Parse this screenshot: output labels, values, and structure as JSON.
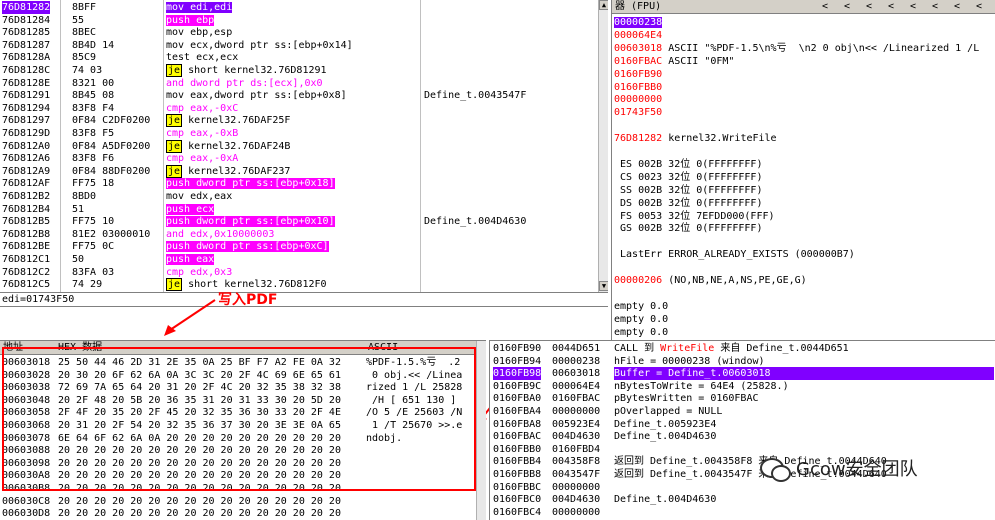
{
  "disasm": {
    "rows": [
      {
        "addr": "76D81282",
        "bytes": "8BFF",
        "asm": "mov edi,edi",
        "cmt": "",
        "sel": true,
        "cls": "sel"
      },
      {
        "addr": "76D81284",
        "bytes": "55",
        "asm": "push ebp",
        "cmt": "",
        "cls": "push"
      },
      {
        "addr": "76D81285",
        "bytes": "8BEC",
        "asm": "mov ebp,esp",
        "cmt": ""
      },
      {
        "addr": "76D81287",
        "bytes": "8B4D 14",
        "asm": "mov ecx,dword ptr ss:[ebp+0x14]",
        "cmt": ""
      },
      {
        "addr": "76D8128A",
        "bytes": "85C9",
        "asm": "test ecx,ecx",
        "cmt": ""
      },
      {
        "addr": "76D8128C",
        "bytes": "74 03",
        "asm": "short kernel32.76D81291",
        "cmt": "",
        "je": "je"
      },
      {
        "addr": "76D8128E",
        "bytes": "8321 00",
        "asm": "and dword ptr ds:[ecx],0x0",
        "cmt": "",
        "cls": "cmp"
      },
      {
        "addr": "76D81291",
        "bytes": "8B45 08",
        "asm": "mov eax,dword ptr ss:[ebp+0x8]",
        "cmt": "Define_t.0043547F"
      },
      {
        "addr": "76D81294",
        "bytes": "83F8 F4",
        "asm": "cmp eax,-0xC",
        "cmt": "",
        "cls": "cmp"
      },
      {
        "addr": "76D81297",
        "bytes": "0F84 C2DF0200",
        "asm": "kernel32.76DAF25F",
        "cmt": "",
        "je": "je"
      },
      {
        "addr": "76D8129D",
        "bytes": "83F8 F5",
        "asm": "cmp eax,-0xB",
        "cmt": "",
        "cls": "cmp"
      },
      {
        "addr": "76D812A0",
        "bytes": "0F84 A5DF0200",
        "asm": "kernel32.76DAF24B",
        "cmt": "",
        "je": "je"
      },
      {
        "addr": "76D812A6",
        "bytes": "83F8 F6",
        "asm": "cmp eax,-0xA",
        "cmt": "",
        "cls": "cmp"
      },
      {
        "addr": "76D812A9",
        "bytes": "0F84 88DF0200",
        "asm": "kernel32.76DAF237",
        "cmt": "",
        "je": "je"
      },
      {
        "addr": "76D812AF",
        "bytes": "FF75 18",
        "asm": "push dword ptr ss:[ebp+0x18]",
        "cmt": "",
        "cls": "push"
      },
      {
        "addr": "76D812B2",
        "bytes": "8BD0",
        "asm": "mov edx,eax",
        "cmt": ""
      },
      {
        "addr": "76D812B4",
        "bytes": "51",
        "asm": "push ecx",
        "cmt": "",
        "cls": "push"
      },
      {
        "addr": "76D812B5",
        "bytes": "FF75 10",
        "asm": "push dword ptr ss:[ebp+0x10]",
        "cmt": "Define_t.004D4630",
        "cls": "push"
      },
      {
        "addr": "76D812B8",
        "bytes": "81E2 03000010",
        "asm": "and edx,0x10000003",
        "cmt": "",
        "cls": "cmp"
      },
      {
        "addr": "76D812BE",
        "bytes": "FF75 0C",
        "asm": "push dword ptr ss:[ebp+0xC]",
        "cmt": "",
        "cls": "push"
      },
      {
        "addr": "76D812C1",
        "bytes": "50",
        "asm": "push eax",
        "cmt": "",
        "cls": "push"
      },
      {
        "addr": "76D812C2",
        "bytes": "83FA 03",
        "asm": "cmp edx,0x3",
        "cmt": "",
        "cls": "cmp"
      },
      {
        "addr": "76D812C5",
        "bytes": "74 29",
        "asm": "short kernel32.76D812F0",
        "cmt": "",
        "je": "je"
      }
    ],
    "status": "edi=01743F50",
    "annotation": "写入PDF"
  },
  "regs": {
    "title": "器 (FPU)",
    "nav": [
      "<",
      "<",
      "<",
      "<",
      "<",
      "<",
      "<",
      "<"
    ],
    "lines": [
      {
        "t": "00000238",
        "hl": true
      },
      {
        "t": "000064E4",
        "c": "red"
      },
      {
        "t": "00603018",
        "c": "red",
        "extra": " ASCII \"%PDF-1.5\\n%亏  \\n2 0 obj\\n<< /Linearized 1 /L"
      },
      {
        "t": "0160FBAC",
        "c": "red",
        "extra": " ASCII \"0FM\""
      },
      {
        "t": "0160FB90",
        "c": "red"
      },
      {
        "t": "0160FBB0",
        "c": "red"
      },
      {
        "t": "00000000",
        "c": "red"
      },
      {
        "t": "01743F50",
        "c": "red"
      },
      {
        "t": ""
      },
      {
        "t": "76D81282",
        "c": "red",
        "extra": " kernel32.WriteFile"
      },
      {
        "t": ""
      },
      {
        "t": " ES 002B 32位 0(FFFFFFFF)"
      },
      {
        "t": " CS 0023 32位 0(FFFFFFFF)"
      },
      {
        "t": " SS 002B 32位 0(FFFFFFFF)"
      },
      {
        "t": " DS 002B 32位 0(FFFFFFFF)"
      },
      {
        "t": " FS 0053 32位 7EFDD000(FFF)"
      },
      {
        "t": " GS 002B 32位 0(FFFFFFFF)"
      },
      {
        "t": ""
      },
      {
        "t": " LastErr ERROR_ALREADY_EXISTS (000000B7)"
      },
      {
        "t": ""
      },
      {
        "t": "00000206",
        "c": "red",
        "extra": " (NO,NB,NE,A,NS,PE,GE,G)"
      },
      {
        "t": ""
      },
      {
        "t": "empty 0.0"
      },
      {
        "t": "empty 0.0"
      },
      {
        "t": "empty 0.0"
      },
      {
        "t": "empty 0.0"
      },
      {
        "t": "empty 0.0"
      }
    ]
  },
  "hex": {
    "col_addr": "地址",
    "col_hex": "HEX 数据",
    "col_ascii": "ASCII",
    "rows": [
      {
        "a": "00603018",
        "h": "25 50 44 46 2D 31 2E 35 0A 25 BF F7 A2 FE 0A 32",
        "s": "%PDF-1.5.%亏  .2"
      },
      {
        "a": "00603028",
        "h": "20 30 20 6F 62 6A 0A 3C 3C 20 2F 4C 69 6E 65 61",
        "s": " 0 obj.<< /Linea"
      },
      {
        "a": "00603038",
        "h": "72 69 7A 65 64 20 31 20 2F 4C 20 32 35 38 32 38",
        "s": "rized 1 /L 25828"
      },
      {
        "a": "00603048",
        "h": "20 2F 48 20 5B 20 36 35 31 20 31 33 30 20 5D 20",
        "s": " /H [ 651 130 ] "
      },
      {
        "a": "00603058",
        "h": "2F 4F 20 35 20 2F 45 20 32 35 36 30 33 20 2F 4E",
        "s": "/O 5 /E 25603 /N"
      },
      {
        "a": "00603068",
        "h": "20 31 20 2F 54 20 32 35 36 37 30 20 3E 3E 0A 65",
        "s": " 1 /T 25670 >>.e"
      },
      {
        "a": "00603078",
        "h": "6E 64 6F 62 6A 0A 20 20 20 20 20 20 20 20 20 20",
        "s": "ndobj.          "
      },
      {
        "a": "00603088",
        "h": "20 20 20 20 20 20 20 20 20 20 20 20 20 20 20 20",
        "s": ""
      },
      {
        "a": "00603098",
        "h": "20 20 20 20 20 20 20 20 20 20 20 20 20 20 20 20",
        "s": ""
      },
      {
        "a": "006030A8",
        "h": "20 20 20 20 20 20 20 20 20 20 20 20 20 20 20 20",
        "s": ""
      },
      {
        "a": "006030B8",
        "h": "20 20 20 20 20 20 20 20 20 20 20 20 20 20 20 20",
        "s": ""
      },
      {
        "a": "006030C8",
        "h": "20 20 20 20 20 20 20 20 20 20 20 20 20 20 20 20",
        "s": ""
      },
      {
        "a": "006030D8",
        "h": "20 20 20 20 20 20 20 20 20 20 20 20 20 20 20 20",
        "s": ""
      }
    ]
  },
  "stack": {
    "rows": [
      {
        "a": "0160FB90",
        "v": "0044D651",
        "c": "CALL 到 ",
        "w": "WriteFile",
        "c2": " 来自 Define_t.0044D651"
      },
      {
        "a": "0160FB94",
        "v": "00000238",
        "c": "hFile = 00000238 (window)"
      },
      {
        "a": "0160FB98",
        "v": "00603018",
        "c": "Buffer = Define_t.00603018",
        "sel": true
      },
      {
        "a": "0160FB9C",
        "v": "000064E4",
        "c": "nBytesToWrite = 64E4 (25828.)"
      },
      {
        "a": "0160FBA0",
        "v": "0160FBAC",
        "c": "pBytesWritten = 0160FBAC"
      },
      {
        "a": "0160FBA4",
        "v": "00000000",
        "c": "pOverlapped = NULL"
      },
      {
        "a": "0160FBA8",
        "v": "005923E4",
        "c": "Define_t.005923E4"
      },
      {
        "a": "0160FBAC",
        "v": "004D4630",
        "c": "Define_t.004D4630"
      },
      {
        "a": "0160FBB0",
        "v": "0160FBD4",
        "c": ""
      },
      {
        "a": "0160FBB4",
        "v": "004358F8",
        "c": "返回到 Define_t.004358F8 来自 Define_t.0044D640"
      },
      {
        "a": "0160FBB8",
        "v": "0043547F",
        "c": "返回到 Define_t.0043547F 来自 Define_t.0044D640"
      },
      {
        "a": "0160FBBC",
        "v": "00000000",
        "c": ""
      },
      {
        "a": "0160FBC0",
        "v": "004D4630",
        "c": "Define_t.004D4630"
      },
      {
        "a": "0160FBC4",
        "v": "00000000",
        "c": ""
      }
    ]
  },
  "watermark": "Gcow安全团队"
}
